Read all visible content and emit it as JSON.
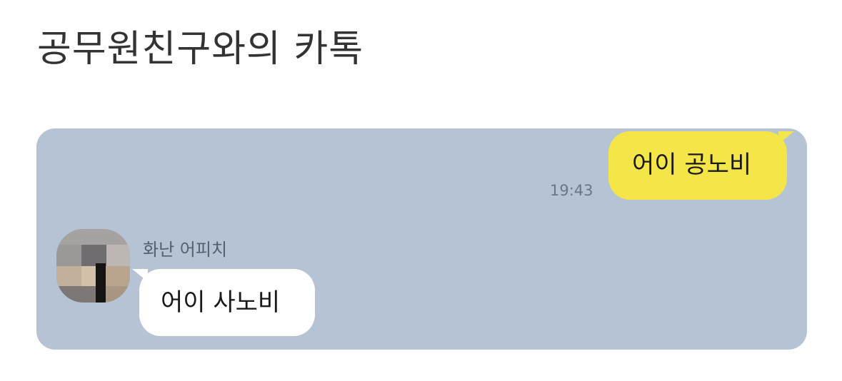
{
  "page": {
    "title": "공무원친구와의 카톡"
  },
  "chat": {
    "background_color": "#b5c3d4",
    "messages": [
      {
        "direction": "sent",
        "text": "어이 공노비",
        "time": "19:43",
        "bubble_color": "#f4e649"
      },
      {
        "direction": "received",
        "sender": "화난 어피치",
        "text": "어이 사노비",
        "bubble_color": "#ffffff",
        "avatar": "pixelated-profile-avatar"
      }
    ]
  }
}
